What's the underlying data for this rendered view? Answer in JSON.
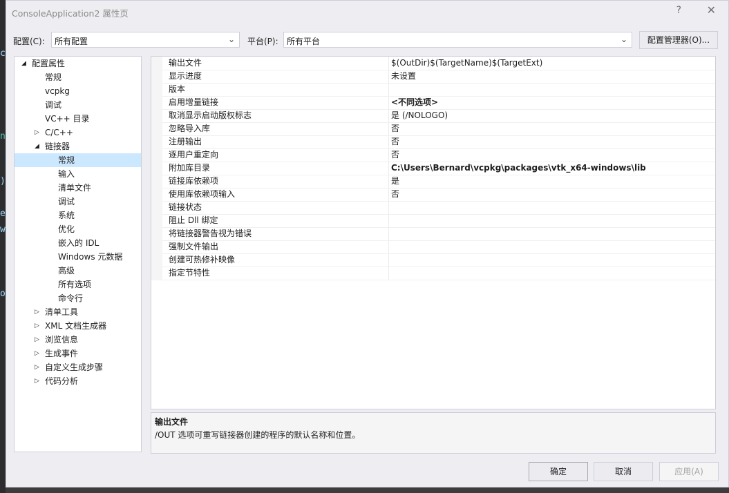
{
  "window": {
    "title": "ConsoleApplication2 属性页",
    "help_glyph": "?",
    "close_glyph": "✕"
  },
  "config_row": {
    "config_label": "配置(C):",
    "config_value": "所有配置",
    "platform_label": "平台(P):",
    "platform_value": "所有平台",
    "manager_button": "配置管理器(O)..."
  },
  "tree": [
    {
      "label": "配置属性",
      "toggle": "◢",
      "level": 0,
      "selected": false
    },
    {
      "label": "常规",
      "toggle": "",
      "level": 1,
      "selected": false
    },
    {
      "label": "vcpkg",
      "toggle": "",
      "level": 1,
      "selected": false
    },
    {
      "label": "调试",
      "toggle": "",
      "level": 1,
      "selected": false
    },
    {
      "label": "VC++ 目录",
      "toggle": "",
      "level": 1,
      "selected": false
    },
    {
      "label": "C/C++",
      "toggle": "▷",
      "level": 1,
      "selected": false
    },
    {
      "label": "链接器",
      "toggle": "◢",
      "level": 1,
      "selected": false
    },
    {
      "label": "常规",
      "toggle": "",
      "level": 2,
      "selected": true
    },
    {
      "label": "输入",
      "toggle": "",
      "level": 2,
      "selected": false
    },
    {
      "label": "清单文件",
      "toggle": "",
      "level": 2,
      "selected": false
    },
    {
      "label": "调试",
      "toggle": "",
      "level": 2,
      "selected": false
    },
    {
      "label": "系统",
      "toggle": "",
      "level": 2,
      "selected": false
    },
    {
      "label": "优化",
      "toggle": "",
      "level": 2,
      "selected": false
    },
    {
      "label": "嵌入的 IDL",
      "toggle": "",
      "level": 2,
      "selected": false
    },
    {
      "label": "Windows 元数据",
      "toggle": "",
      "level": 2,
      "selected": false
    },
    {
      "label": "高级",
      "toggle": "",
      "level": 2,
      "selected": false
    },
    {
      "label": "所有选项",
      "toggle": "",
      "level": 2,
      "selected": false
    },
    {
      "label": "命令行",
      "toggle": "",
      "level": 2,
      "selected": false
    },
    {
      "label": "清单工具",
      "toggle": "▷",
      "level": 1,
      "selected": false
    },
    {
      "label": "XML 文档生成器",
      "toggle": "▷",
      "level": 1,
      "selected": false
    },
    {
      "label": "浏览信息",
      "toggle": "▷",
      "level": 1,
      "selected": false
    },
    {
      "label": "生成事件",
      "toggle": "▷",
      "level": 1,
      "selected": false
    },
    {
      "label": "自定义生成步骤",
      "toggle": "▷",
      "level": 1,
      "selected": false
    },
    {
      "label": "代码分析",
      "toggle": "▷",
      "level": 1,
      "selected": false
    }
  ],
  "properties": [
    {
      "name": "输出文件",
      "value": "$(OutDir)$(TargetName)$(TargetExt)",
      "bold": false
    },
    {
      "name": "显示进度",
      "value": "未设置",
      "bold": false
    },
    {
      "name": "版本",
      "value": "",
      "bold": false
    },
    {
      "name": "启用增量链接",
      "value": "<不同选项>",
      "bold": true
    },
    {
      "name": "取消显示启动版权标志",
      "value": "是 (/NOLOGO)",
      "bold": false
    },
    {
      "name": "忽略导入库",
      "value": "否",
      "bold": false
    },
    {
      "name": "注册输出",
      "value": "否",
      "bold": false
    },
    {
      "name": "逐用户重定向",
      "value": "否",
      "bold": false
    },
    {
      "name": "附加库目录",
      "value": "C:\\Users\\Bernard\\vcpkg\\packages\\vtk_x64-windows\\lib",
      "bold": true
    },
    {
      "name": "链接库依赖项",
      "value": "是",
      "bold": false
    },
    {
      "name": "使用库依赖项输入",
      "value": "否",
      "bold": false
    },
    {
      "name": "链接状态",
      "value": "",
      "bold": false
    },
    {
      "name": "阻止 Dll 绑定",
      "value": "",
      "bold": false
    },
    {
      "name": "将链接器警告视为错误",
      "value": "",
      "bold": false
    },
    {
      "name": "强制文件输出",
      "value": "",
      "bold": false
    },
    {
      "name": "创建可热修补映像",
      "value": "",
      "bold": false
    },
    {
      "name": "指定节特性",
      "value": "",
      "bold": false
    }
  ],
  "description": {
    "title": "输出文件",
    "text": "/OUT 选项可重写链接器创建的程序的默认名称和位置。"
  },
  "buttons": {
    "ok": "确定",
    "cancel": "取消",
    "apply": "应用(A)"
  },
  "background_text": [
    "c",
    ")",
    "e",
    "w",
    "n",
    "o"
  ]
}
